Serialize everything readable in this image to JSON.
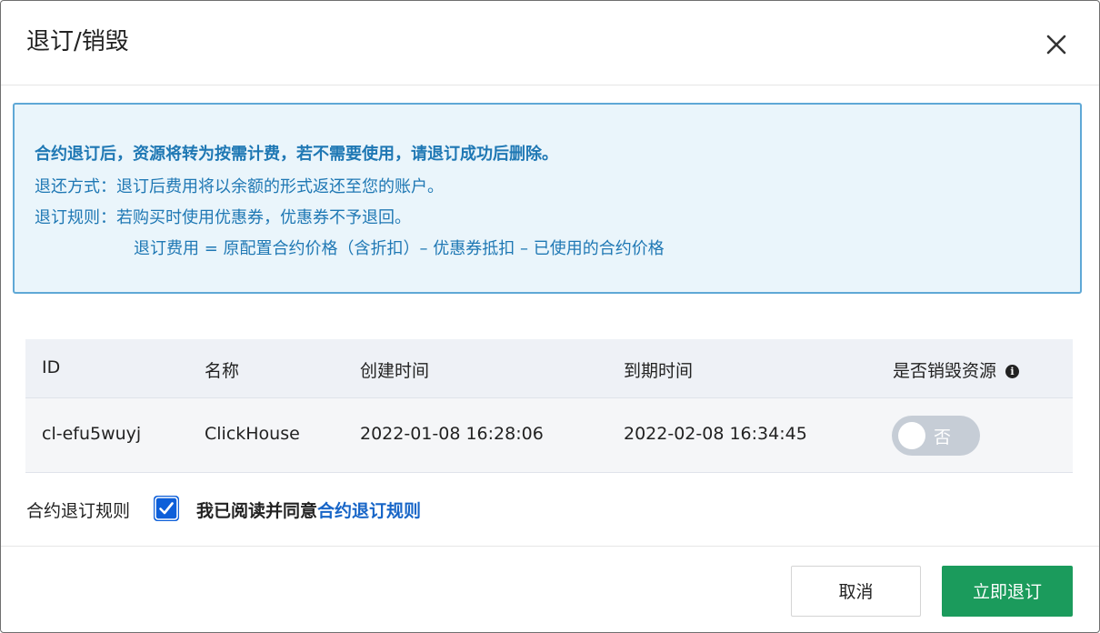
{
  "dialog": {
    "title": "退订/销毁",
    "close_icon": "close-icon"
  },
  "notice": {
    "headline": "合约退订后，资源将转为按需计费，若不需要使用，请退订成功后删除。",
    "refund_method": "退还方式：退订后费用将以余额的形式返还至您的账户。",
    "refund_rule": "退订规则：若购买时使用优惠券，优惠券不予退回。",
    "refund_formula": "退订费用 = 原配置合约价格（含折扣）– 优惠券抵扣 – 已使用的合约价格",
    "colors": {
      "text": "#1f78b4",
      "background": "#eaf5fb",
      "border": "#5fa8d6"
    }
  },
  "table": {
    "headers": {
      "id": "ID",
      "name": "名称",
      "created": "创建时间",
      "expires": "到期时间",
      "destroy": "是否销毁资源"
    },
    "rows": [
      {
        "id": "cl-efu5wuyj",
        "name": "ClickHouse",
        "created": "2022-01-08 16:28:06",
        "expires": "2022-02-08 16:34:45",
        "destroy_label": "否",
        "destroy_on": false
      }
    ]
  },
  "agreement": {
    "label": "合约退订规则",
    "checked": true,
    "text": "我已阅读并同意",
    "link": "合约退订规则"
  },
  "footer": {
    "cancel_label": "取消",
    "confirm_label": "立即退订",
    "confirm_color": "#1b9b5c"
  }
}
